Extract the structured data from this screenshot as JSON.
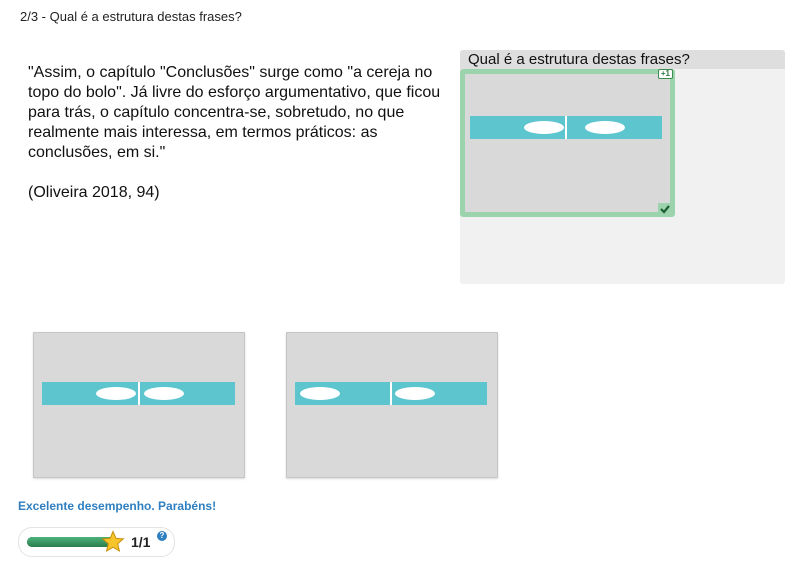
{
  "header": {
    "title": "2/3 - Qual é a estrutura destas frases?"
  },
  "quote": {
    "text": "\"Assim, o capítulo \"Conclusões\" surge como \"a cereja no topo do bolo\". Já livre do esforço argumentativo, que ficou para trás, o capítulo concentra-se, sobretudo, no que realmente mais interessa, em termos práticos: as conclusões, em si.\"",
    "citation": "(Oliveira 2018, 94)"
  },
  "question_panel": {
    "title": "Qual é a estrutura destas frases?",
    "placed_card": {
      "badge": "+1",
      "status": "correct"
    }
  },
  "options": [
    {
      "ellipses": "right-aligned"
    },
    {
      "ellipses": "left-aligned"
    }
  ],
  "feedback": {
    "message": "Excelente desempenho. Parabéns!"
  },
  "score": {
    "text": "1/1",
    "progress": 1.0,
    "help": "?"
  },
  "colors": {
    "accent": "#2f7fc0",
    "bar": "#5cc5ce",
    "correct": "#9bd3ac",
    "progress": "#2e8c57"
  },
  "icons": {
    "star": "star-icon",
    "check": "checkmark-icon",
    "help": "help-icon"
  }
}
